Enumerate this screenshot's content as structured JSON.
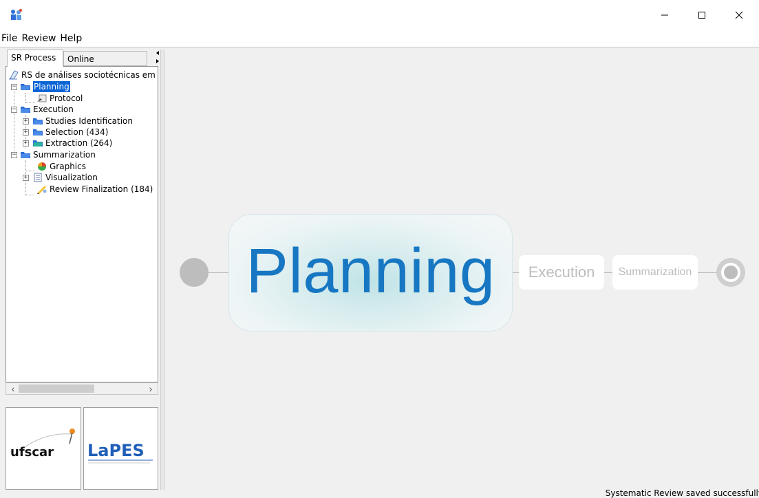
{
  "menu": [
    "File",
    "Review",
    "Help"
  ],
  "tabs": {
    "process": "SR Process",
    "community": "Online Community"
  },
  "tree": {
    "root": "RS de análises sociotécnicas em",
    "planning": "Planning",
    "protocol": "Protocol",
    "execution": "Execution",
    "studies": "Studies Identification",
    "selection": "Selection (434)",
    "extraction": "Extraction (264)",
    "summarization": "Summarization",
    "graphics": "Graphics",
    "visualization": "Visualization",
    "finalization": "Review Finalization (184)"
  },
  "logos": {
    "left": "ufscar",
    "right": "LaPES"
  },
  "process": {
    "planning": "Planning",
    "execution": "Execution",
    "summarization": "Summarization"
  },
  "status": "Systematic Review saved successfully",
  "colors": {
    "accent": "#1777c2",
    "selection": "#0a64d6",
    "folder": "#2f6fd6"
  },
  "icons": {
    "app": "app-logo-icon",
    "folder": "folder-icon",
    "chart": "pie-chart-icon",
    "doc": "document-icon"
  }
}
